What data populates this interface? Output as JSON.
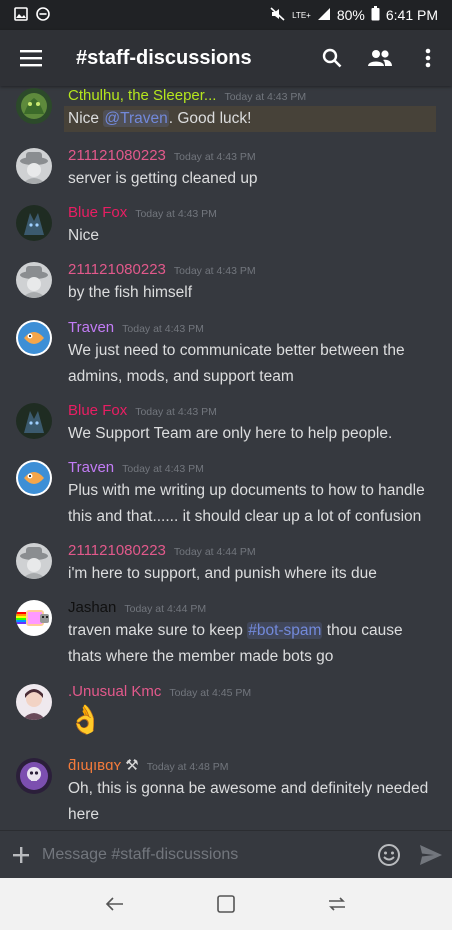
{
  "status": {
    "battery": "80%",
    "time": "6:41 PM",
    "network": "LTE+"
  },
  "header": {
    "title": "#staff-discussions"
  },
  "messages": [
    {
      "author": "Cthulhu, the Sleeper...",
      "color": "#b5e61d",
      "time": "Today at 4:43 PM",
      "lines": [
        "Nice ",
        "@Traven",
        ". Good luck!"
      ],
      "avatar": "cthulhu"
    },
    {
      "author": "211121080223",
      "color": "#e2598b",
      "time": "Today at 4:43 PM",
      "text": "server is getting cleaned up",
      "avatar": "hat"
    },
    {
      "author": "Blue Fox",
      "color": "#e91e63",
      "time": "Today at 4:43 PM",
      "text": "Nice",
      "avatar": "fox"
    },
    {
      "author": "211121080223",
      "color": "#e2598b",
      "time": "Today at 4:43 PM",
      "text": "by the fish himself",
      "avatar": "hat"
    },
    {
      "author": "Traven",
      "color": "#c27cf5",
      "time": "Today at 4:43 PM",
      "text": "We just need to communicate better between the admins, mods, and support team",
      "avatar": "fish"
    },
    {
      "author": "Blue Fox",
      "color": "#e91e63",
      "time": "Today at 4:43 PM",
      "text": "We Support Team are only here to help people.",
      "avatar": "fox"
    },
    {
      "author": "Traven",
      "color": "#c27cf5",
      "time": "Today at 4:43 PM",
      "text": "Plus with me writing up documents to how to handle this and that...... it should clear up a lot of confusion",
      "avatar": "fish"
    },
    {
      "author": "211121080223",
      "color": "#e2598b",
      "time": "Today at 4:44 PM",
      "text": "i'm here to support, and punish where its due",
      "avatar": "hat"
    },
    {
      "author": "Jashan",
      "color": "#101010",
      "time": "Today at 4:44 PM",
      "pre": "traven make sure to keep ",
      "channel": "#bot-spam",
      "post": " thou cause thats where the member made bots go",
      "avatar": "nyan"
    },
    {
      "author": ".Unusual Kmc",
      "color": "#e2598b",
      "time": "Today at 4:45 PM",
      "emoji": "👌",
      "avatar": "kmc"
    },
    {
      "author": "ƌıɰıʙɑʏ",
      "color": "#f47b3b",
      "badge": "⚒",
      "time": "Today at 4:48 PM",
      "text": "Oh, this is gonna be awesome and definitely needed here",
      "avatar": "skull"
    }
  ],
  "composer": {
    "placeholder": "Message #staff-discussions"
  },
  "icons": {
    "menu": "hamburger-icon",
    "search": "search-icon",
    "members": "members-icon",
    "more": "more-vertical-icon",
    "add": "plus-icon",
    "emoji": "emoji-icon",
    "send": "send-icon",
    "back": "back-icon",
    "home": "home-icon",
    "recents": "recents-icon"
  }
}
